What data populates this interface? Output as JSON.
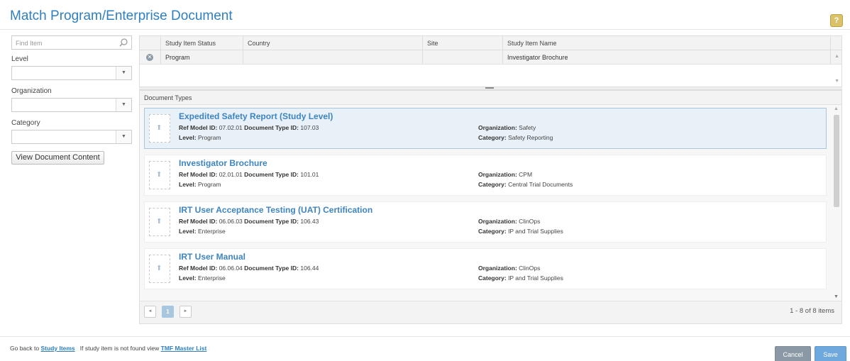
{
  "dialog": {
    "title": "Match Program/Enterprise Document",
    "help_label": "?"
  },
  "filters": {
    "search_placeholder": "Find Item",
    "level_label": "Level",
    "level_value": "",
    "organization_label": "Organization",
    "organization_value": "",
    "category_label": "Category",
    "category_value": "",
    "view_button": "View Document Content"
  },
  "study_grid": {
    "columns": [
      "Study Item Status",
      "Country",
      "Site",
      "Study Item Name"
    ],
    "rows": [
      {
        "status": "Program",
        "country": "",
        "site": "",
        "name": "Investigator Brochure"
      }
    ]
  },
  "doc_panel": {
    "header": "Document Types",
    "labels": {
      "ref_model_id": "Ref Model ID:",
      "doc_type_id": "Document Type ID:",
      "level": "Level:",
      "organization": "Organization:",
      "category": "Category:"
    },
    "items": [
      {
        "title": "Expedited Safety Report (Study Level)",
        "ref_model_id": "07.02.01",
        "doc_type_id": "107.03",
        "level": "Program",
        "organization": "Safety",
        "category": "Safety Reporting",
        "selected": true
      },
      {
        "title": "Investigator Brochure",
        "ref_model_id": "02.01.01",
        "doc_type_id": "101.01",
        "level": "Program",
        "organization": "CPM",
        "category": "Central Trial Documents",
        "selected": false
      },
      {
        "title": "IRT User Acceptance Testing (UAT) Certification",
        "ref_model_id": "06.06.03",
        "doc_type_id": "106.43",
        "level": "Enterprise",
        "organization": "ClinOps",
        "category": "IP and Trial Supplies",
        "selected": false
      },
      {
        "title": "IRT User Manual",
        "ref_model_id": "06.06.04",
        "doc_type_id": "106.44",
        "level": "Enterprise",
        "organization": "ClinOps",
        "category": "IP and Trial Supplies",
        "selected": false
      }
    ],
    "pager": {
      "prev": "◄",
      "current_page": "1",
      "next": "►",
      "info": "1 - 8 of 8 items"
    }
  },
  "footer": {
    "go_back_prefix": "Go back to",
    "study_items_link": "Study Items",
    "not_found_text": "If study item is not found view",
    "tmf_link": "TMF Master List",
    "cancel_label": "Cancel",
    "save_label": "Save"
  },
  "colors": {
    "title": "#2f7fbf",
    "doc_title": "#3d84c2",
    "selected_bg": "#e8f1f8",
    "save_button": "#6fa8dc",
    "cancel_button": "#8b98a5"
  },
  "icons": {
    "search": "search-icon",
    "remove": "remove-circle-icon",
    "document": "document-upload-icon",
    "dropdown": "chevron-down-icon"
  }
}
